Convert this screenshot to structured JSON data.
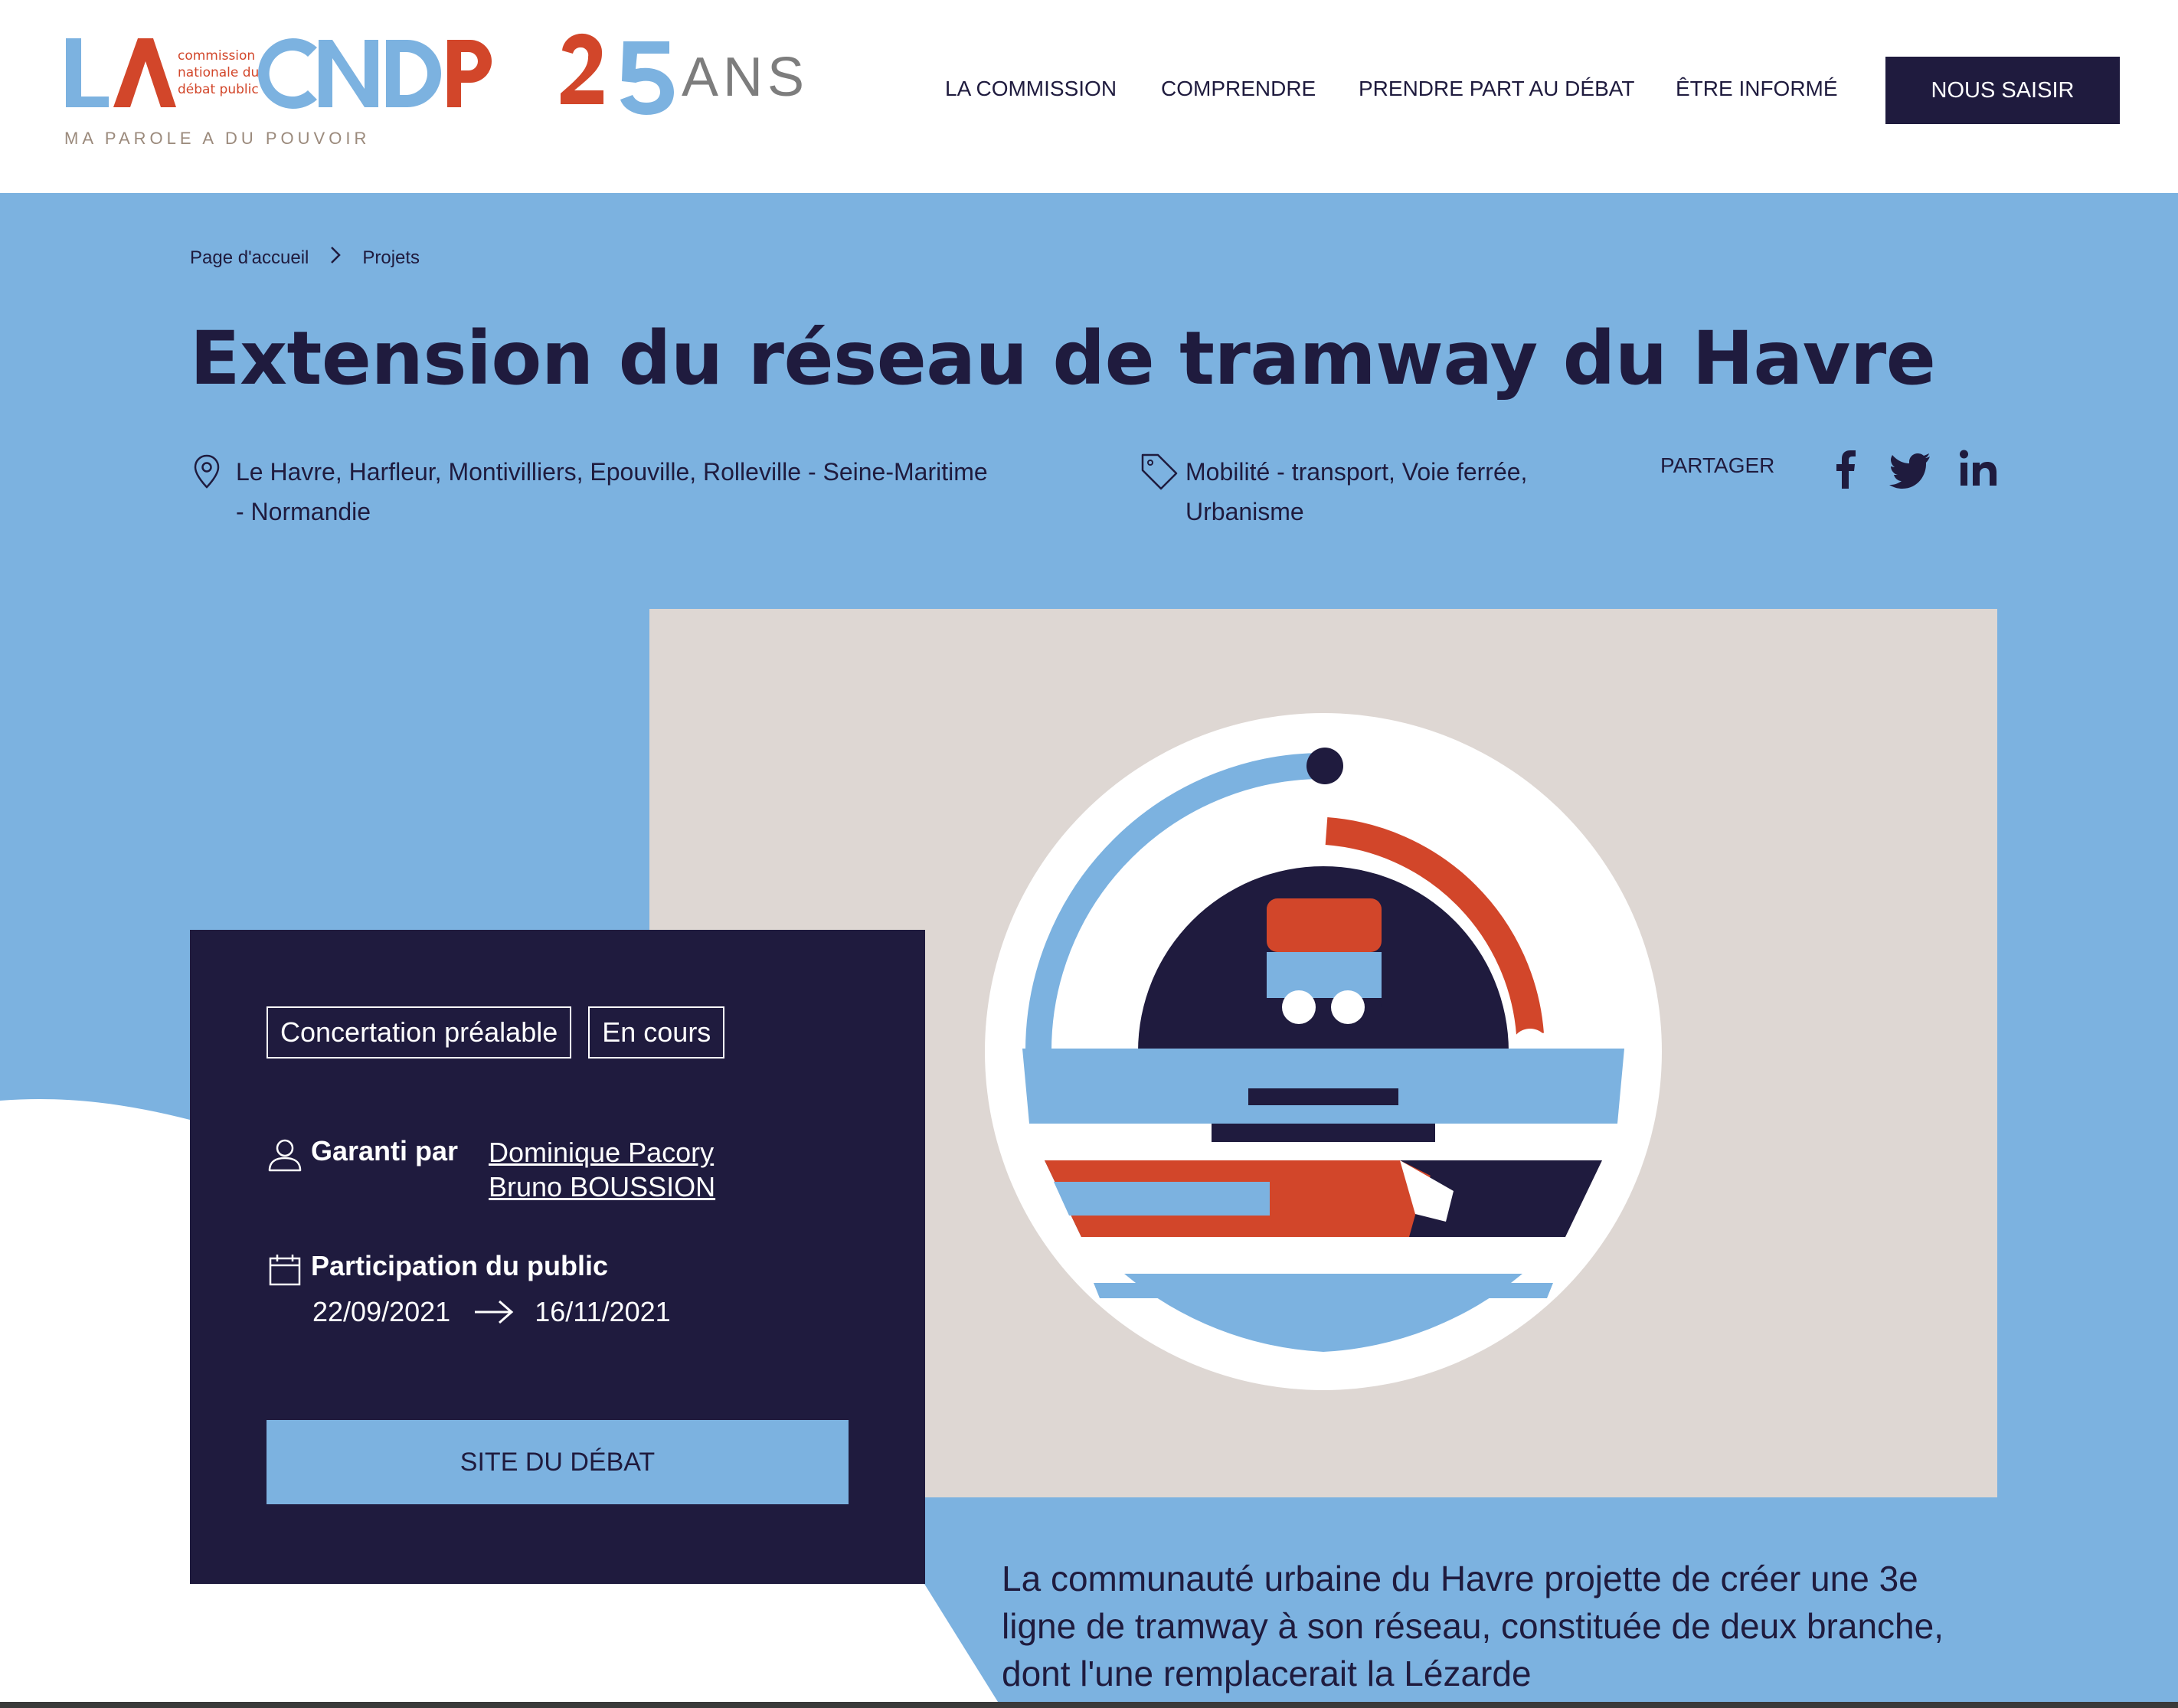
{
  "logo": {
    "line1": "commission",
    "line2": "nationale du",
    "line3": "débat public",
    "ans": "ANS",
    "tagline": "MA PAROLE A DU POUVOIR"
  },
  "nav": {
    "items": [
      "LA COMMISSION",
      "COMPRENDRE",
      "PRENDRE PART AU DÉBAT",
      "ÊTRE INFORMÉ"
    ],
    "cta": "NOUS SAISIR"
  },
  "breadcrumb": {
    "home": "Page d'accueil",
    "current": "Projets"
  },
  "project": {
    "title": "Extension du réseau de tramway du Havre",
    "location": "Le Havre, Harfleur, Montivilliers, Epouville, Rolleville - Seine-Maritime - Normandie",
    "tags": "Mobilité - transport, Voie ferrée, Urbanisme",
    "share_label": "PARTAGER",
    "share_icons": [
      "facebook-icon",
      "twitter-icon",
      "linkedin-icon"
    ]
  },
  "card": {
    "badge_type": "Concertation préalable",
    "badge_status": "En cours",
    "guaranteed_label": "Garanti par",
    "guarantors": [
      "Dominique Pacory",
      "Bruno BOUSSION"
    ],
    "participation_label": "Participation du public",
    "date_start": "22/09/2021",
    "date_end": "16/11/2021",
    "site_button": "SITE DU DÉBAT"
  },
  "description": "La communauté urbaine du Havre projette de créer une 3e ligne de tramway à son réseau, constituée de deux branche, dont l'une remplacerait la Lézarde",
  "colors": {
    "navy": "#1f1b3e",
    "sky": "#7cb2e0",
    "red": "#d2462a",
    "beige": "#ded7d3"
  }
}
